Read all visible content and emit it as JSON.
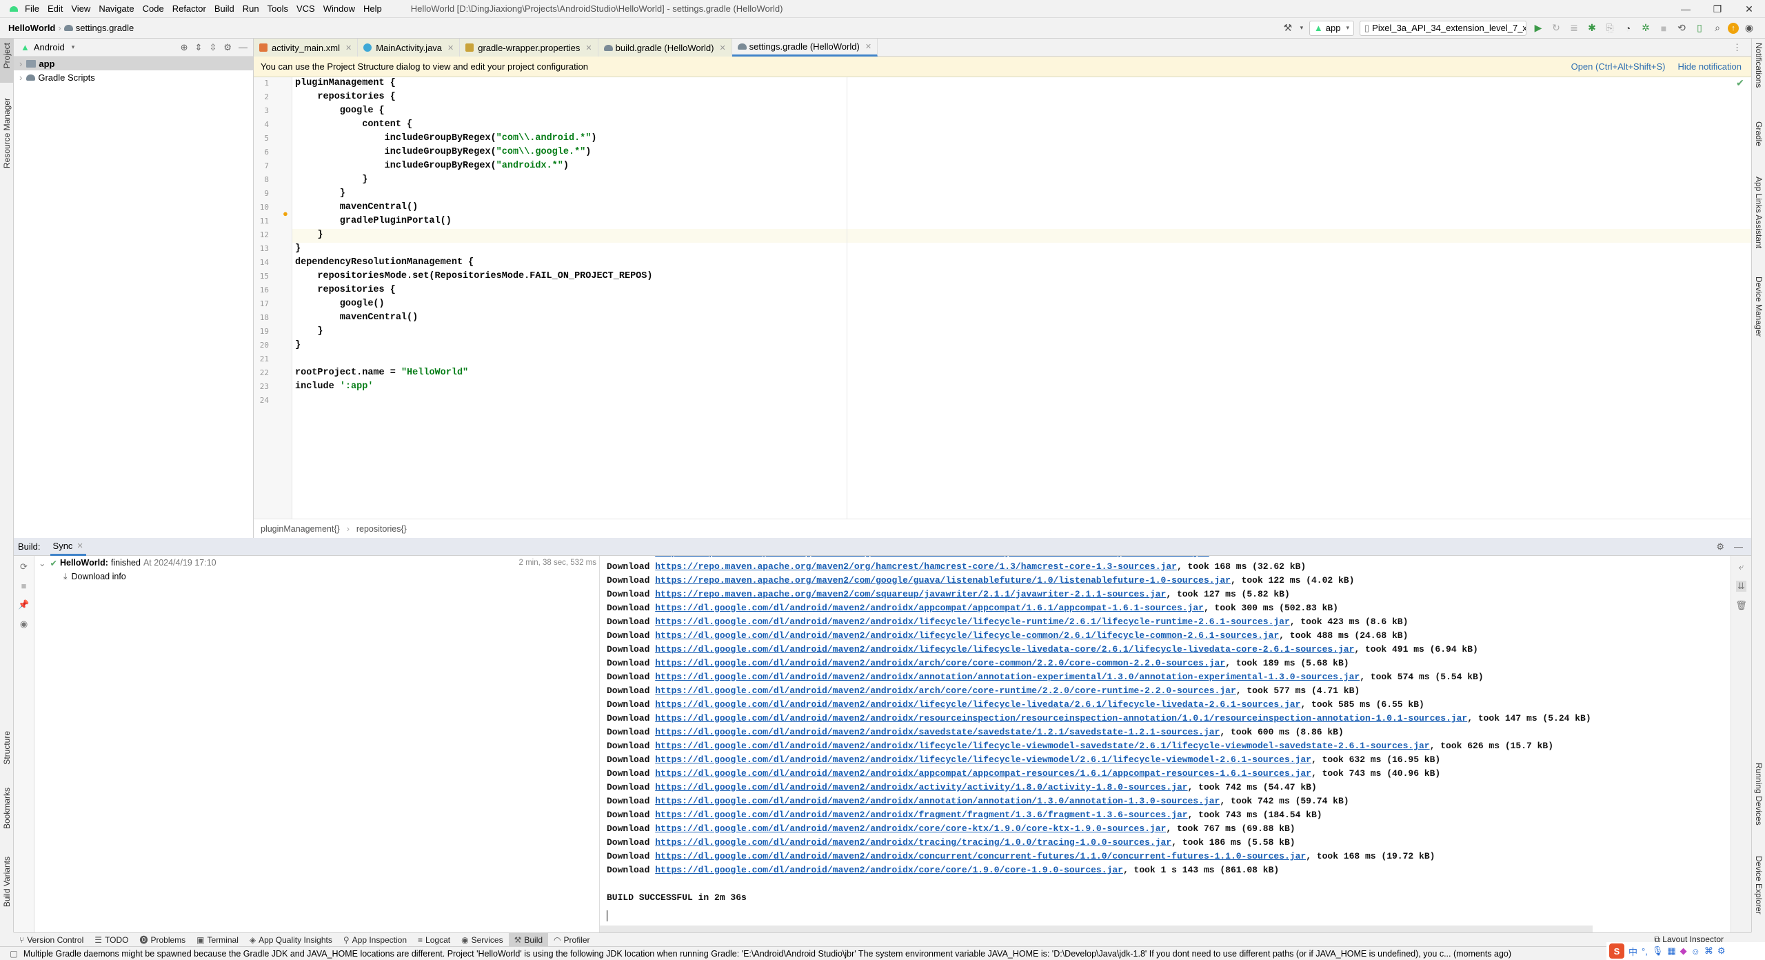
{
  "window": {
    "title": "HelloWorld [D:\\DingJiaxiong\\Projects\\AndroidStudio\\HelloWorld] - settings.gradle (HelloWorld)",
    "controls": {
      "minimize": "—",
      "maximize": "❐",
      "close": "✕"
    }
  },
  "menu": [
    "File",
    "Edit",
    "View",
    "Navigate",
    "Code",
    "Refactor",
    "Build",
    "Run",
    "Tools",
    "VCS",
    "Window",
    "Help"
  ],
  "navbar": {
    "project": "HelloWorld",
    "file": "settings.gradle",
    "run_config": "app",
    "device": "Pixel_3a_API_34_extension_level_7_x..."
  },
  "left_stripe": {
    "top": "Project",
    "resource": "Resource Manager",
    "structure": "Structure",
    "bookmarks": "Bookmarks",
    "build_variants": "Build Variants"
  },
  "right_stripe": {
    "notifications": "Notifications",
    "gradle": "Gradle",
    "app_links": "App Links Assistant",
    "device_manager": "Device Manager",
    "running_devices": "Running Devices",
    "device_explorer": "Device Explorer"
  },
  "project_panel": {
    "view": "Android",
    "items": [
      {
        "label": "app",
        "selected": true
      },
      {
        "label": "Gradle Scripts",
        "selected": false
      }
    ]
  },
  "tabs": [
    {
      "label": "activity_main.xml",
      "icon": "xml-file-icon",
      "color": "#e0763b",
      "active": false
    },
    {
      "label": "MainActivity.java",
      "icon": "java-class-icon",
      "color": "#3ea8d6",
      "active": false
    },
    {
      "label": "gradle-wrapper.properties",
      "icon": "properties-file-icon",
      "color": "#c9a33a",
      "active": false
    },
    {
      "label": "build.gradle (HelloWorld)",
      "icon": "gradle-file-icon",
      "color": "#7a8a96",
      "active": false
    },
    {
      "label": "settings.gradle (HelloWorld)",
      "icon": "gradle-file-icon",
      "color": "#7a8a96",
      "active": true
    }
  ],
  "notification": {
    "text": "You can use the Project Structure dialog to view and edit your project configuration",
    "open": "Open (Ctrl+Alt+Shift+S)",
    "hide": "Hide notification"
  },
  "code": [
    "pluginManagement {",
    "    repositories {",
    "        google {",
    "            content {",
    "                includeGroupByRegex(\"com\\\\.android.*\")",
    "                includeGroupByRegex(\"com\\\\.google.*\")",
    "                includeGroupByRegex(\"androidx.*\")",
    "            }",
    "        }",
    "        mavenCentral()",
    "        gradlePluginPortal()",
    "    }",
    "}",
    "dependencyResolutionManagement {",
    "    repositoriesMode.set(RepositoriesMode.FAIL_ON_PROJECT_REPOS)",
    "    repositories {",
    "        google()",
    "        mavenCentral()",
    "    }",
    "}",
    "",
    "rootProject.name = \"HelloWorld\"",
    "include ':app'",
    ""
  ],
  "current_line": 12,
  "editor_breadcrumb": [
    "pluginManagement{}",
    "repositories{}"
  ],
  "build": {
    "label": "Build:",
    "tab": "Sync",
    "tree": {
      "project": "HelloWorld:",
      "status": "finished",
      "time": "At 2024/4/19 17:10",
      "duration": "2 min, 38 sec, 532 ms",
      "child": "Download info"
    },
    "downloads": [
      {
        "url": "https://repo.maven.apache.org/maven2/org/hamcrest/hamcrest-core/1.3/hamcrest-core-1.3-sources.jar",
        "took": "took 168 ms (32.62 kB)"
      },
      {
        "url": "https://repo.maven.apache.org/maven2/com/google/guava/listenablefuture/1.0/listenablefuture-1.0-sources.jar",
        "took": "took 122 ms (4.02 kB)"
      },
      {
        "url": "https://repo.maven.apache.org/maven2/com/squareup/javawriter/2.1.1/javawriter-2.1.1-sources.jar",
        "took": "took 127 ms (5.82 kB)"
      },
      {
        "url": "https://dl.google.com/dl/android/maven2/androidx/appcompat/appcompat/1.6.1/appcompat-1.6.1-sources.jar",
        "took": "took 300 ms (502.83 kB)"
      },
      {
        "url": "https://dl.google.com/dl/android/maven2/androidx/lifecycle/lifecycle-runtime/2.6.1/lifecycle-runtime-2.6.1-sources.jar",
        "took": "took 423 ms (8.6 kB)"
      },
      {
        "url": "https://dl.google.com/dl/android/maven2/androidx/lifecycle/lifecycle-common/2.6.1/lifecycle-common-2.6.1-sources.jar",
        "took": "took 488 ms (24.68 kB)"
      },
      {
        "url": "https://dl.google.com/dl/android/maven2/androidx/lifecycle/lifecycle-livedata-core/2.6.1/lifecycle-livedata-core-2.6.1-sources.jar",
        "took": "took 491 ms (6.94 kB)"
      },
      {
        "url": "https://dl.google.com/dl/android/maven2/androidx/arch/core/core-common/2.2.0/core-common-2.2.0-sources.jar",
        "took": "took 189 ms (5.68 kB)"
      },
      {
        "url": "https://dl.google.com/dl/android/maven2/androidx/annotation/annotation-experimental/1.3.0/annotation-experimental-1.3.0-sources.jar",
        "took": "took 574 ms (5.54 kB)"
      },
      {
        "url": "https://dl.google.com/dl/android/maven2/androidx/arch/core/core-runtime/2.2.0/core-runtime-2.2.0-sources.jar",
        "took": "took 577 ms (4.71 kB)"
      },
      {
        "url": "https://dl.google.com/dl/android/maven2/androidx/lifecycle/lifecycle-livedata/2.6.1/lifecycle-livedata-2.6.1-sources.jar",
        "took": "took 585 ms (6.55 kB)"
      },
      {
        "url": "https://dl.google.com/dl/android/maven2/androidx/resourceinspection/resourceinspection-annotation/1.0.1/resourceinspection-annotation-1.0.1-sources.jar",
        "took": "took 147 ms (5.24 kB)"
      },
      {
        "url": "https://dl.google.com/dl/android/maven2/androidx/savedstate/savedstate/1.2.1/savedstate-1.2.1-sources.jar",
        "took": "took 600 ms (8.86 kB)"
      },
      {
        "url": "https://dl.google.com/dl/android/maven2/androidx/lifecycle/lifecycle-viewmodel-savedstate/2.6.1/lifecycle-viewmodel-savedstate-2.6.1-sources.jar",
        "took": "took 626 ms (15.7 kB)"
      },
      {
        "url": "https://dl.google.com/dl/android/maven2/androidx/lifecycle/lifecycle-viewmodel/2.6.1/lifecycle-viewmodel-2.6.1-sources.jar",
        "took": "took 632 ms (16.95 kB)"
      },
      {
        "url": "https://dl.google.com/dl/android/maven2/androidx/appcompat/appcompat-resources/1.6.1/appcompat-resources-1.6.1-sources.jar",
        "took": "took 743 ms (40.96 kB)"
      },
      {
        "url": "https://dl.google.com/dl/android/maven2/androidx/activity/activity/1.8.0/activity-1.8.0-sources.jar",
        "took": "took 742 ms (54.47 kB)"
      },
      {
        "url": "https://dl.google.com/dl/android/maven2/androidx/annotation/annotation/1.3.0/annotation-1.3.0-sources.jar",
        "took": "took 742 ms (59.74 kB)"
      },
      {
        "url": "https://dl.google.com/dl/android/maven2/androidx/fragment/fragment/1.3.6/fragment-1.3.6-sources.jar",
        "took": "took 743 ms (184.54 kB)"
      },
      {
        "url": "https://dl.google.com/dl/android/maven2/androidx/core/core-ktx/1.9.0/core-ktx-1.9.0-sources.jar",
        "took": "took 767 ms (69.88 kB)"
      },
      {
        "url": "https://dl.google.com/dl/android/maven2/androidx/tracing/tracing/1.0.0/tracing-1.0.0-sources.jar",
        "took": "took 186 ms (5.58 kB)"
      },
      {
        "url": "https://dl.google.com/dl/android/maven2/androidx/concurrent/concurrent-futures/1.1.0/concurrent-futures-1.1.0-sources.jar",
        "took": "took 168 ms (19.72 kB)"
      },
      {
        "url": "https://dl.google.com/dl/android/maven2/androidx/core/core/1.9.0/core-1.9.0-sources.jar",
        "took": "took 1 s 143 ms (861.08 kB)"
      }
    ],
    "download_word": "Download",
    "result": "BUILD SUCCESSFUL in 2m 36s"
  },
  "bottom_tabs": [
    {
      "label": "Version Control",
      "icon": "⑂",
      "active": false
    },
    {
      "label": "TODO",
      "icon": "☰",
      "active": false
    },
    {
      "label": "Problems",
      "icon": "⓿",
      "active": false
    },
    {
      "label": "Terminal",
      "icon": "▣",
      "active": false
    },
    {
      "label": "App Quality Insights",
      "icon": "◈",
      "active": false
    },
    {
      "label": "App Inspection",
      "icon": "⚲",
      "active": false
    },
    {
      "label": "Logcat",
      "icon": "≡",
      "active": false
    },
    {
      "label": "Services",
      "icon": "◉",
      "active": false
    },
    {
      "label": "Build",
      "icon": "⚒",
      "active": true
    },
    {
      "label": "Profiler",
      "icon": "◠",
      "active": false
    }
  ],
  "layout_inspector": "Layout Inspector",
  "status_message": "Multiple Gradle daemons might be spawned because the Gradle JDK and JAVA_HOME locations are different. Project 'HelloWorld' is using the following JDK location when running Gradle: 'E:\\Android\\Android Studio\\jbr' The system environment variable JAVA_HOME is: 'D:\\Develop\\Java\\jdk-1.8' If you dont need to use different paths (or if JAVA_HOME is undefined), you c... (moments ago)",
  "ime": [
    "S",
    "中",
    "°,",
    "🎤",
    "▦",
    "👕",
    "☺",
    "⌘",
    "⚙"
  ]
}
